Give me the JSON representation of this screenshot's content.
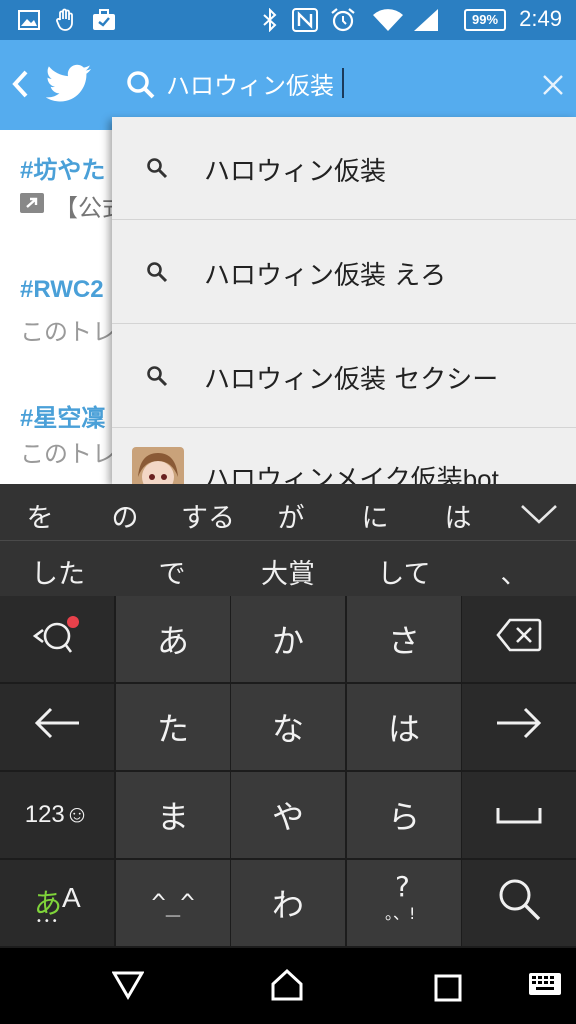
{
  "status_bar": {
    "time": "2:49",
    "battery": "99%",
    "icons": [
      "image-icon",
      "hand-icon",
      "briefcase-icon",
      "bluetooth-icon",
      "nfc-icon",
      "alarm-icon",
      "wifi-icon",
      "signal-icon",
      "battery-icon"
    ]
  },
  "app_bar": {
    "search_query": "ハロウィン仮装",
    "accent": "#55acee"
  },
  "background_trends": [
    {
      "tag": "#坊やた",
      "sub": "【公式"
    },
    {
      "tag": "#RWC2",
      "sub": "このトレ"
    },
    {
      "tag": "#星空凜",
      "sub": "このトレ"
    }
  ],
  "suggestions": [
    {
      "text": "ハロウィン仮装"
    },
    {
      "text": "ハロウィン仮装 えろ"
    },
    {
      "text": "ハロウィン仮装 セクシー"
    },
    {
      "text": "ハロウィンメイク仮装bot"
    }
  ],
  "keyboard": {
    "candidates_row1": [
      "を",
      "の",
      "する",
      "が",
      "に",
      "は"
    ],
    "candidates_row2": [
      "した",
      "で",
      "大賞",
      "して",
      "、"
    ],
    "keys": {
      "a": "あ",
      "ka": "か",
      "sa": "さ",
      "ta": "た",
      "na": "な",
      "ha": "は",
      "ma": "ま",
      "ya": "や",
      "ra": "ら",
      "emoticon": "^_^",
      "wa": "わ",
      "punct_top": "?",
      "punct_bottom": "。、!",
      "numeric": "123☺",
      "kana_mode_jp": "あ",
      "kana_mode_en": "A",
      "kana_mode_dots": "•••"
    }
  }
}
